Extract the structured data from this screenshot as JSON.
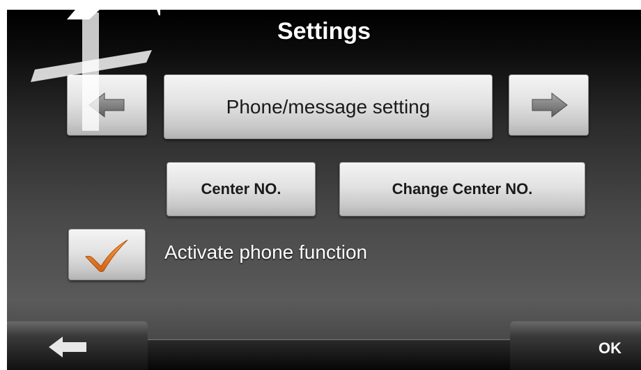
{
  "header": {
    "title": "Settings"
  },
  "pager": {
    "current_section": "Phone/message setting",
    "prev_icon": "arrow-left-icon",
    "next_icon": "arrow-right-icon"
  },
  "actions": {
    "center_no_label": "Center NO.",
    "change_center_no_label": "Change Center NO."
  },
  "options": {
    "activate_phone": {
      "label": "Activate phone function",
      "checked": true,
      "check_color": "#e8761e"
    }
  },
  "footer": {
    "back_icon": "back-arrow-icon",
    "ok_label": "OK"
  },
  "colors": {
    "background_top": "#000000",
    "background_bottom": "#5b5a5b",
    "button_light": "#f4f4f4",
    "button_dark": "#b3b3b3",
    "text_light": "#ffffff",
    "text_dark": "#1a1a1a"
  }
}
